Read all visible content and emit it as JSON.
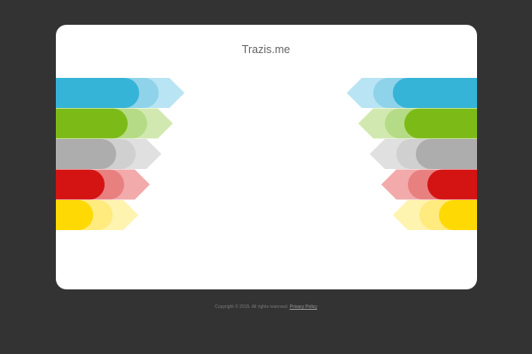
{
  "site": {
    "title": "Trazis.me"
  },
  "footer": {
    "copyright": "Copyright © 2015. All rights reserved.",
    "privacy_link": "Privacy Policy"
  },
  "colors": {
    "background": "#333333",
    "card": "#ffffff",
    "stripes": [
      {
        "name": "blue",
        "solid": "#35b4d7",
        "mid": "#8fd3ea",
        "light": "#b9e4f3"
      },
      {
        "name": "green",
        "solid": "#7cbb17",
        "mid": "#b6db86",
        "light": "#d1e9b0"
      },
      {
        "name": "gray",
        "solid": "#adadad",
        "mid": "#d0d0d0",
        "light": "#e0e0e0"
      },
      {
        "name": "red",
        "solid": "#d41313",
        "mid": "#e98080",
        "light": "#f2aaaa"
      },
      {
        "name": "yellow",
        "solid": "#ffd903",
        "mid": "#ffeb7e",
        "light": "#fff3b0"
      }
    ]
  }
}
